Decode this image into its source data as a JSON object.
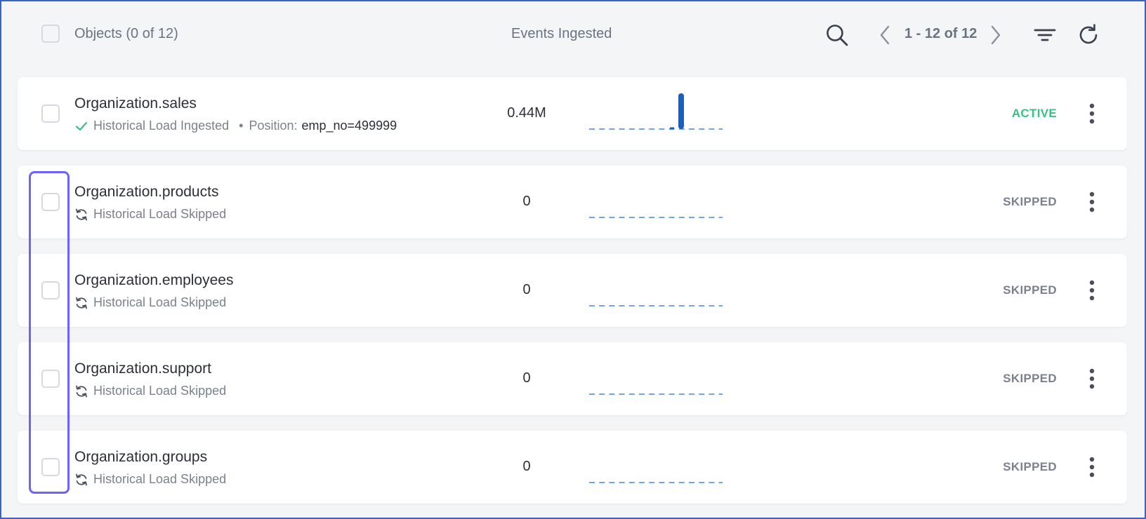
{
  "header": {
    "objects_label": "Objects (0 of 12)",
    "events_label": "Events Ingested",
    "page_info": "1 - 12 of 12"
  },
  "icons": {
    "search": "search-icon",
    "prev": "chevron-left-icon",
    "next": "chevron-right-icon",
    "filter": "filter-icon",
    "refresh": "refresh-icon",
    "check": "check-icon",
    "sync": "sync-icon",
    "more": "more-vertical-icon"
  },
  "colors": {
    "active": "#3bbf86",
    "skipped": "#7b818d",
    "spark_bar": "#1b5fb8",
    "spark_dash": "#4a90e2",
    "selection": "#6c63ff"
  },
  "rows": [
    {
      "name": "Organization.sales",
      "sub": "Historical Load Ingested",
      "sub_icon": "check-icon",
      "position_label": "Position:",
      "position_value": "emp_no=499999",
      "count": "0.44M",
      "status": "ACTIVE",
      "spark_peak_index": 7
    },
    {
      "name": "Organization.products",
      "sub": "Historical Load Skipped",
      "sub_icon": "sync-icon",
      "count": "0",
      "status": "SKIPPED"
    },
    {
      "name": "Organization.employees",
      "sub": "Historical Load Skipped",
      "sub_icon": "sync-icon",
      "count": "0",
      "status": "SKIPPED"
    },
    {
      "name": "Organization.support",
      "sub": "Historical Load Skipped",
      "sub_icon": "sync-icon",
      "count": "0",
      "status": "SKIPPED"
    },
    {
      "name": "Organization.groups",
      "sub": "Historical Load Skipped",
      "sub_icon": "sync-icon",
      "count": "0",
      "status": "SKIPPED"
    }
  ]
}
